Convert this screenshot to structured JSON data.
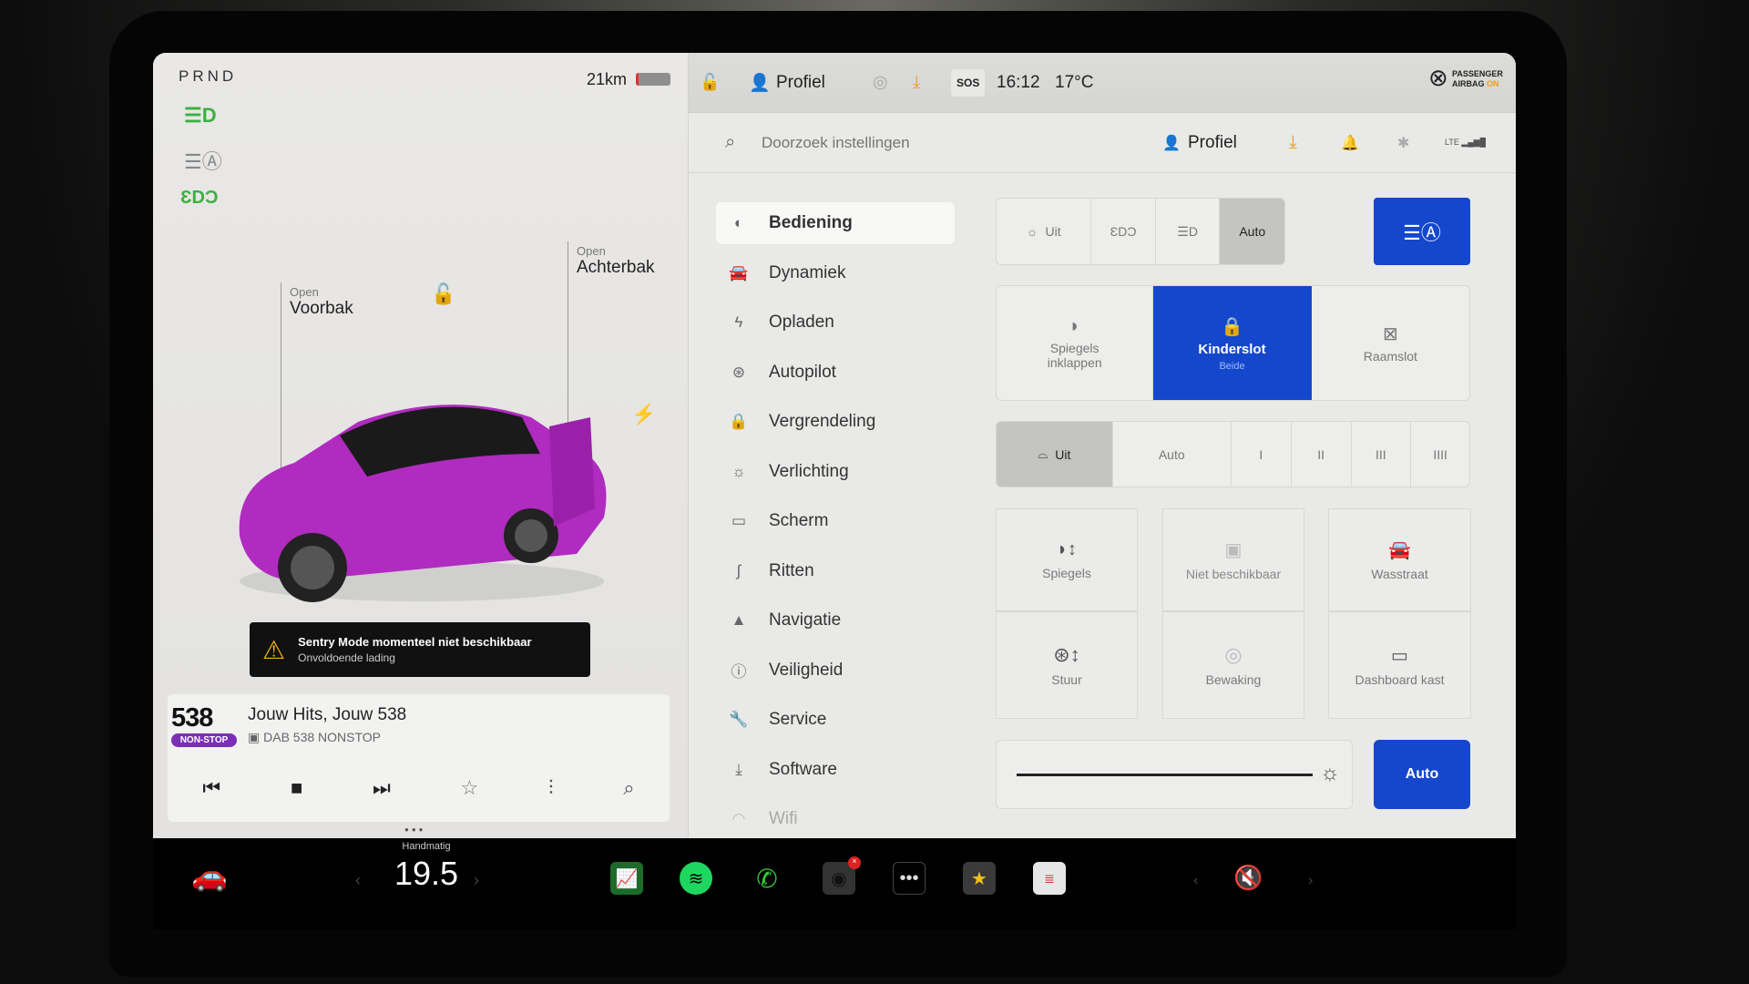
{
  "left_panel": {
    "gear": "PRND",
    "range": "21km",
    "battery_percent": 4,
    "frunk": {
      "action": "Open",
      "label": "Voorbak"
    },
    "trunk": {
      "action": "Open",
      "label": "Achterbak"
    },
    "car_color": "#b02bc0",
    "alert": {
      "title": "Sentry Mode momenteel niet beschikbaar",
      "subtitle": "Onvoldoende lading"
    },
    "media": {
      "logo_number": "538",
      "logo_badge": "NON-STOP",
      "title": "Jouw Hits, Jouw 538",
      "source": "DAB 538 NONSTOP"
    }
  },
  "status_bar": {
    "profile": "Profiel",
    "sos": "SOS",
    "time": "16:12",
    "temperature": "17°C",
    "airbag_line1": "PASSENGER",
    "airbag_line2": "AIRBAG",
    "airbag_state": "ON"
  },
  "settings": {
    "search_placeholder": "Doorzoek instellingen",
    "profile": "Profiel",
    "network": "LTE",
    "menu": [
      {
        "label": "Bediening",
        "icon": "toggle-icon",
        "selected": true
      },
      {
        "label": "Dynamiek",
        "icon": "car-icon"
      },
      {
        "label": "Opladen",
        "icon": "bolt-icon"
      },
      {
        "label": "Autopilot",
        "icon": "steering-wheel-icon"
      },
      {
        "label": "Vergrendeling",
        "icon": "lock-icon"
      },
      {
        "label": "Verlichting",
        "icon": "light-icon"
      },
      {
        "label": "Scherm",
        "icon": "screen-icon"
      },
      {
        "label": "Ritten",
        "icon": "trips-icon"
      },
      {
        "label": "Navigatie",
        "icon": "navigation-icon"
      },
      {
        "label": "Veiligheid",
        "icon": "safety-icon"
      },
      {
        "label": "Service",
        "icon": "wrench-icon"
      },
      {
        "label": "Software",
        "icon": "download-icon"
      },
      {
        "label": "Wifi",
        "icon": "wifi-icon"
      }
    ],
    "lights": {
      "off": "Uit",
      "auto": "Auto",
      "selected": "Auto"
    },
    "locks": {
      "mirrors_fold": "Spiegels inklappen",
      "child_lock": "Kinderslot",
      "child_lock_value": "Beide",
      "window_lock": "Raamslot"
    },
    "wipers": {
      "off": "Uit",
      "auto": "Auto",
      "levels": [
        "I",
        "II",
        "III",
        "IIII"
      ],
      "selected": "Uit"
    },
    "grid": [
      "Spiegels",
      "Niet beschikbaar",
      "Wasstraat",
      "Stuur",
      "Bewaking",
      "Dashboard kast"
    ],
    "brightness": {
      "value_percent": 100,
      "auto": "Auto"
    },
    "accent": "#1447cc"
  },
  "dock": {
    "climate_mode": "Handmatig",
    "temperature": "19.5"
  }
}
